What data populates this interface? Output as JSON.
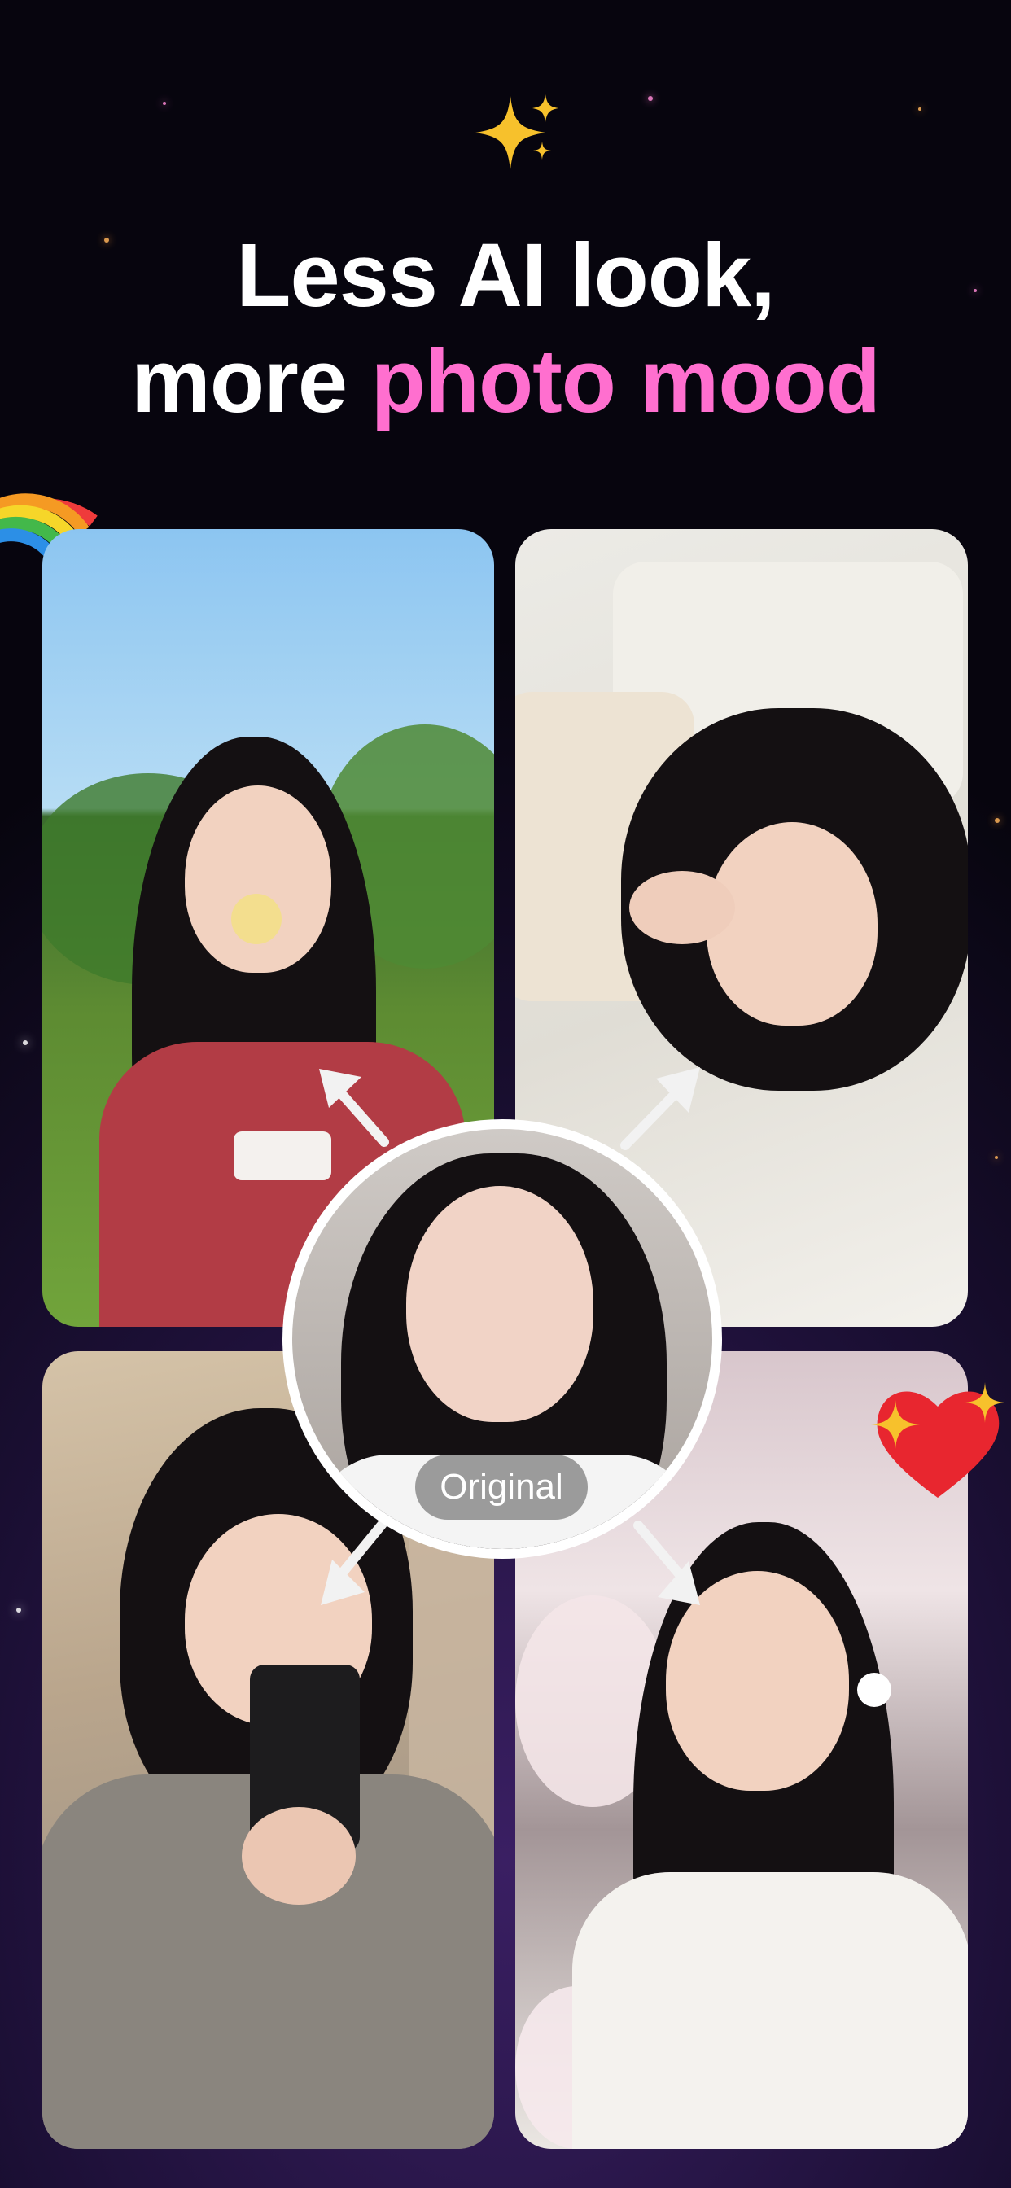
{
  "headline": {
    "line1": "Less AI look,",
    "line2_plain": "more ",
    "line2_accent": "photo mood"
  },
  "badge": {
    "original_label": "Original"
  },
  "colors": {
    "accent": "#ff6fcf",
    "text": "#ffffff",
    "background_dark": "#07050e",
    "background_purple": "#3a1f63"
  },
  "icons": [
    "sparkles-icon",
    "rainbow-icon",
    "sparkling-heart-icon",
    "arrow-icon"
  ],
  "photos": [
    {
      "position": "top-left",
      "scene": "outdoor park"
    },
    {
      "position": "top-right",
      "scene": "bed pillow"
    },
    {
      "position": "bottom-left",
      "scene": "mirror selfie"
    },
    {
      "position": "bottom-right",
      "scene": "cherry blossoms"
    }
  ]
}
